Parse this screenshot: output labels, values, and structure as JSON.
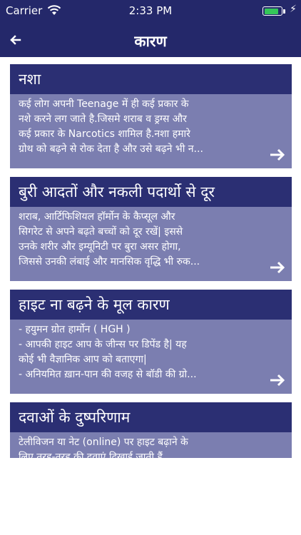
{
  "status_bar": {
    "carrier": "Carrier",
    "time": "2:33 PM",
    "battery_level": 0.9,
    "battery_color": "#34c759"
  },
  "nav": {
    "title": "कारण",
    "back_icon": "arrow-left-icon"
  },
  "theme": {
    "bar_color": "#24286a",
    "card_header_color": "#2b2f73",
    "card_body_color": "#7b7eb0"
  },
  "cards": [
    {
      "title": "नशा",
      "lines": [
        "कई लोग अपनी Teenage में ही कई प्रकार के",
        "नशे करने लग जाते है.जिसमे शराब व ड्रग्स और",
        "कई प्रकार के Narcotics शामिल है.नशा हमारे",
        "ग्रोथ को बढ़ने से रोक देता है और उसे बढ़ने भी न..."
      ]
    },
    {
      "title": "बुरी आदतों और नकली पदार्थो से दूर",
      "lines": [
        "शराब, आर्टिफिशियल हॉर्मोन के कैप्सूल और",
        "सिगरेट से अपने बढ़ते बच्चों को दूर रखें| इससे",
        "उनके शरीर और इम्यूनिटी पर बुरा असर होगा,",
        "जिससे उनकी लंबाई और मानसिक वृद्धि भी रुक..."
      ]
    },
    {
      "title": "हाइट ना बढ़ने के मूल कारण",
      "lines": [
        "- हयुमन ग्रोत हार्मोन ( HGH )",
        "- आपकी हाइट आप के जीन्स पर डिपेंड है| यह",
        "कोई भी वैज्ञानिक आप को बताएगा|",
        "- अनियमित ख़ान-पान की वजह से बॉडी की ग्रो..."
      ]
    },
    {
      "title": "दवाओं के दुष्परिणाम",
      "lines": [
        "टेलीविजन या नेट (online) पर हाइट बढ़ाने के",
        "लिए तरह-तरह की दवाएं दिखाई जाती हैं..."
      ]
    }
  ]
}
